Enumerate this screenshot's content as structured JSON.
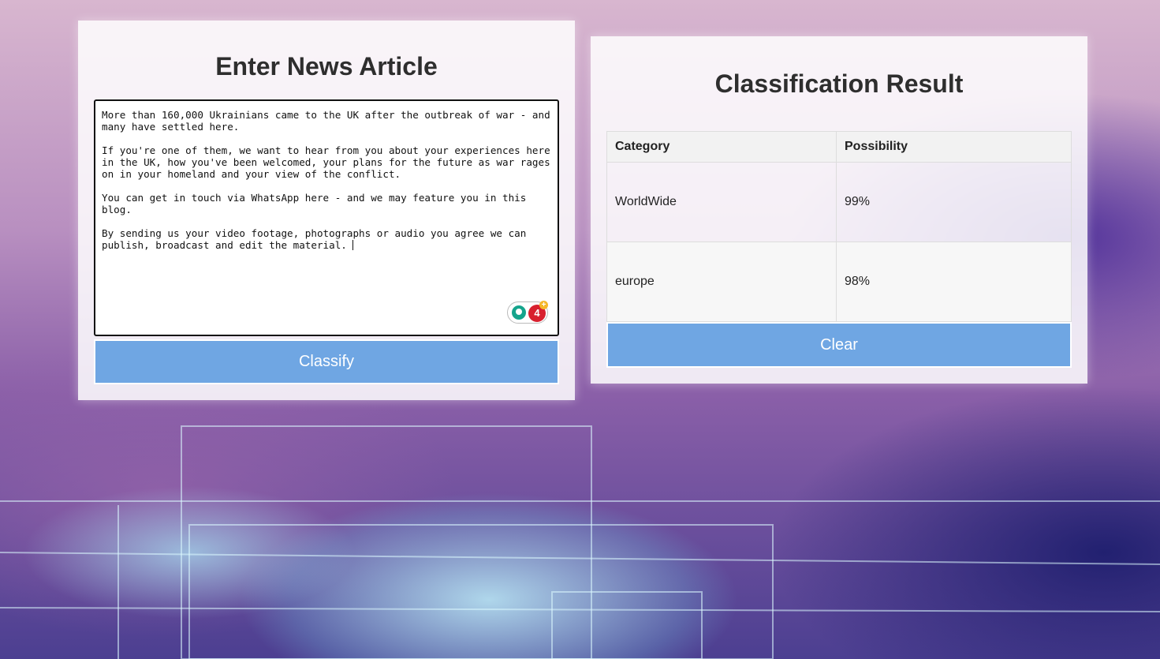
{
  "input_panel": {
    "title": "Enter News Article",
    "article_text": "More than 160,000 Ukrainians came to the UK after the outbreak of war - and\nmany have settled here.\n\nIf you're one of them, we want to hear from you about your experiences here\nin the UK, how you've been welcomed, your plans for the future as war rages\non in your homeland and your view of the conflict.\n\nYou can get in touch via WhatsApp here - and we may feature you in this blog.\n\nBy sending us your video footage, photographs or audio you agree we can\npublish, broadcast and edit the material. ",
    "grammar_badge": {
      "icon": "lightbulb-icon",
      "count": "4",
      "plus": "+"
    },
    "classify_label": "Classify"
  },
  "result_panel": {
    "title": "Classification Result",
    "headers": {
      "category": "Category",
      "possibility": "Possibility"
    },
    "rows": [
      {
        "category": "WorldWide",
        "possibility": "99%"
      },
      {
        "category": "europe",
        "possibility": "98%"
      }
    ],
    "clear_label": "Clear"
  },
  "colors": {
    "button": "#6fa6e3",
    "badge_count": "#d8202e",
    "badge_bulb": "#15a48c"
  }
}
